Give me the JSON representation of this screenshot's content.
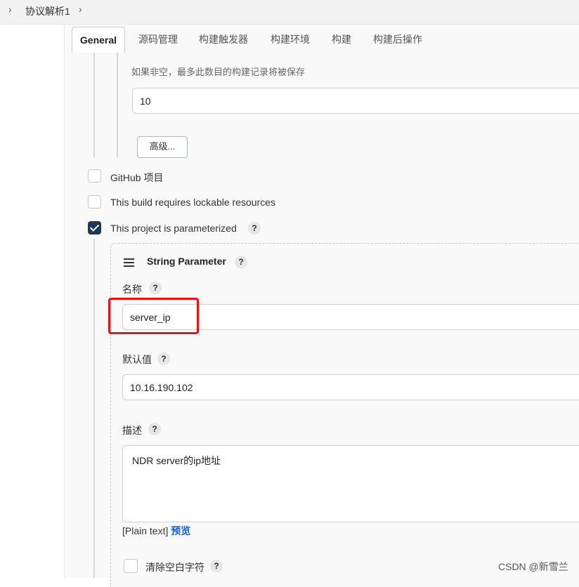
{
  "breadcrumb": {
    "item": "协议解析1"
  },
  "tabs": [
    "General",
    "源码管理",
    "构建触发器",
    "构建环境",
    "构建",
    "构建后操作"
  ],
  "retention": {
    "hint": "如果非空，最多此数目的构建记录将被保存",
    "value": "10",
    "advanced_label": "高级..."
  },
  "options": {
    "github_label": "GitHub 项目",
    "lockable_label": "This build requires lockable resources",
    "parameterized_label": "This project is parameterized"
  },
  "help_mark": "?",
  "string_param": {
    "title": "String Parameter",
    "name_label": "名称",
    "name_value": "server_ip",
    "default_label": "默认值",
    "default_value": "10.16.190.102",
    "desc_label": "描述",
    "desc_value": "NDR server的ip地址",
    "plain_text": "[Plain text]",
    "preview": "预览",
    "trim_label": "清除空白字符"
  },
  "watermark": "CSDN @新雪兰",
  "colors": {
    "checkbox_checked": "#1c3a56",
    "highlight": "#e11111",
    "link": "#1a62c8"
  }
}
